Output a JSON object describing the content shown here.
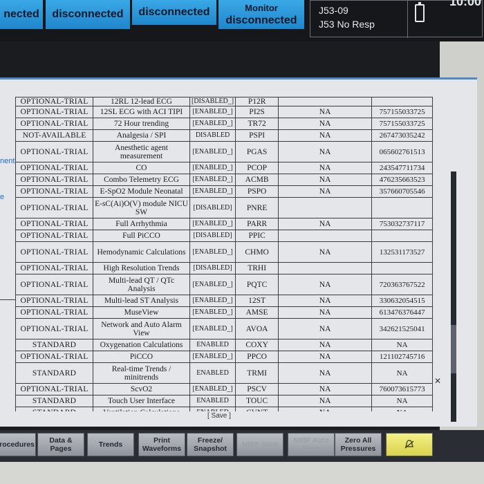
{
  "header": {
    "tiles": [
      "nected",
      "disconnected",
      "disconnected"
    ],
    "monitor_tile": {
      "top": "Monitor",
      "bottom": "disconnected"
    },
    "alarms": [
      "J53-09",
      "J53 No Resp"
    ],
    "clock": "10:00"
  },
  "side_fragments": [
    "nent",
    "e"
  ],
  "table": {
    "rows": [
      {
        "status": "OPTIONAL-TRIAL",
        "option": "12RL 12-lead ECG",
        "state": "[DISABLED_]",
        "code": "P12R",
        "na": "",
        "serial": ""
      },
      {
        "status": "OPTIONAL-TRIAL",
        "option": "12SL ECG with ACI TIPI",
        "state": "[ENABLED_]",
        "code": "PI2S",
        "na": "NA",
        "serial": "757155033725"
      },
      {
        "status": "OPTIONAL-TRIAL",
        "option": "72 Hour trending",
        "state": "[ENABLED_]",
        "code": "TR72",
        "na": "NA",
        "serial": "757155033725"
      },
      {
        "status": "NOT-AVAILABLE",
        "option": "Analgesia / SPI",
        "state": "DISABLED",
        "code": "PSPI",
        "na": "NA",
        "serial": "267473035242"
      },
      {
        "status": "OPTIONAL-TRIAL",
        "option": "Anesthetic agent measurement",
        "state": "[ENABLED_]",
        "code": "PGAS",
        "na": "NA",
        "serial": "065602761513",
        "tall": true
      },
      {
        "status": "OPTIONAL-TRIAL",
        "option": "CO",
        "state": "[ENABLED_]",
        "code": "PCOP",
        "na": "NA",
        "serial": "243547711734"
      },
      {
        "status": "OPTIONAL-TRIAL",
        "option": "Combo Telemetry ECG",
        "state": "[ENABLED_]",
        "code": "ACMB",
        "na": "NA",
        "serial": "476235663523"
      },
      {
        "status": "OPTIONAL-TRIAL",
        "option": "E-SpO2 Module Neonatal",
        "state": "[ENABLED_]",
        "code": "PSPO",
        "na": "NA",
        "serial": "357660705546"
      },
      {
        "status": "OPTIONAL-TRIAL",
        "option": "E-sC(Ai)O(V) module NICU SW",
        "state": "[DISABLED]",
        "code": "PNRE",
        "na": "",
        "serial": "",
        "tall": true
      },
      {
        "status": "OPTIONAL-TRIAL",
        "option": "Full Arrhythmia",
        "state": "[ENABLED_]",
        "code": "PARR",
        "na": "NA",
        "serial": "753032737117"
      },
      {
        "status": "OPTIONAL-TRIAL",
        "option": "Full PiCCO",
        "state": "[DISABLED]",
        "code": "PPIC",
        "na": "",
        "serial": ""
      },
      {
        "status": "OPTIONAL-TRIAL",
        "option": "Hemodynamic Calculations",
        "state": "[ENABLED_]",
        "code": "CHMO",
        "na": "NA",
        "serial": "132531173527",
        "tall": true
      },
      {
        "status": "OPTIONAL-TRIAL",
        "option": "High Resolution Trends",
        "state": "[DISABLED]",
        "code": "TRHI",
        "na": "",
        "serial": ""
      },
      {
        "status": "OPTIONAL-TRIAL",
        "option": "Multi-lead QT / QTc Analysis",
        "state": "[ENABLED_]",
        "code": "PQTC",
        "na": "NA",
        "serial": "720363767522",
        "tall": true
      },
      {
        "status": "OPTIONAL-TRIAL",
        "option": "Multi-lead ST Analysis",
        "state": "[ENABLED_]",
        "code": "12ST",
        "na": "NA",
        "serial": "330632054515"
      },
      {
        "status": "OPTIONAL-TRIAL",
        "option": "MuseView",
        "state": "[ENABLED_]",
        "code": "AMSE",
        "na": "NA",
        "serial": "613476376447"
      },
      {
        "status": "OPTIONAL-TRIAL",
        "option": "Network and Auto Alarm View",
        "state": "[ENABLED_]",
        "code": "AVOA",
        "na": "NA",
        "serial": "342621525041",
        "tall": true
      },
      {
        "status": "STANDARD",
        "option": "Oxygenation Calculations",
        "state": "ENABLED",
        "code": "COXY",
        "na": "NA",
        "serial": "NA"
      },
      {
        "status": "OPTIONAL-TRIAL",
        "option": "PiCCO",
        "state": "[ENABLED_]",
        "code": "PPCO",
        "na": "NA",
        "serial": "121102745716"
      },
      {
        "status": "STANDARD",
        "option": "Real-time Trends / minitrends",
        "state": "ENABLED",
        "code": "TRMI",
        "na": "NA",
        "serial": "NA",
        "tall": true
      },
      {
        "status": "OPTIONAL-TRIAL",
        "option": "ScvO2",
        "state": "[ENABLED_]",
        "code": "PSCV",
        "na": "NA",
        "serial": "760073615773"
      },
      {
        "status": "STANDARD",
        "option": "Touch User Interface",
        "state": "ENABLED",
        "code": "TOUC",
        "na": "NA",
        "serial": "NA"
      },
      {
        "status": "STANDARD",
        "option": "Ventilation Calculations",
        "state": "ENABLED",
        "code": "CVNT",
        "na": "NA",
        "serial": "NA"
      }
    ]
  },
  "save_label": "[ Save ]",
  "softkeys": [
    {
      "label": "Procedures",
      "dim": false
    },
    {
      "label": "Data & Pages",
      "dim": false
    },
    {
      "label": "Trends",
      "dim": false
    },
    {
      "label": "Print Waveforms",
      "dim": false
    },
    {
      "label": "Freeze/ Snapshot",
      "dim": false
    },
    {
      "label": "NIBP Start",
      "dim": true
    },
    {
      "label": "NIBP Auto Start",
      "dim": true
    },
    {
      "label": "Zero All Pressures",
      "dim": false
    }
  ],
  "colors": {
    "tile_blue": "#2b96d8",
    "dialog_bg": "#e4e6ea",
    "alarm_key": "#e6e36a"
  }
}
